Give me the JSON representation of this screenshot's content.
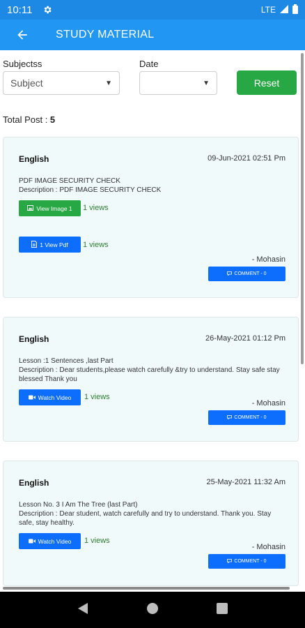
{
  "status_bar": {
    "time": "10:11",
    "network": "LTE"
  },
  "app_bar": {
    "title": "STUDY MATERIAL"
  },
  "filters": {
    "subject_label": "Subjectss",
    "subject_value": "Subject",
    "date_label": "Date",
    "date_value": "",
    "reset_label": "Reset"
  },
  "total_post": {
    "label": "Total Post : ",
    "count": "5"
  },
  "posts": [
    {
      "subject": "English",
      "date": "09-Jun-2021 02:51 Pm",
      "line1": "PDF IMAGE SECURITY CHECK",
      "line2": "Description : PDF IMAGE SECURITY CHECK",
      "image_button": "View Image 1",
      "image_views": "1 views",
      "pdf_button": "1 View Pdf",
      "pdf_views": "1 views",
      "author": "- Mohasin",
      "comment": "COMMENT - 0"
    },
    {
      "subject": "English",
      "date": "26-May-2021 01:12 Pm",
      "line1": "Lesson :1 Sentences ,last Part",
      "line2": "Description : Dear students,please watch carefully &try to understand. Stay safe stay blessed Thank you",
      "video_button": "Watch Video",
      "video_views": "1 views",
      "author": "- Mohasin",
      "comment": "COMMENT - 0"
    },
    {
      "subject": "English",
      "date": "25-May-2021 11:32 Am",
      "line1": "Lesson No. 3 I Am The Tree (last Part)",
      "line2": "Description : Dear student, watch carefully and try to understand. Thank you. Stay safe, stay healthy.",
      "video_button": "Watch Video",
      "video_views": "1 views",
      "author": "- Mohasin",
      "comment": "COMMENT - 0"
    }
  ],
  "colors": {
    "primary": "#2196f3",
    "status_bar": "#1e88e5",
    "green": "#28a745",
    "blue_button": "#0d6efd",
    "card_bg": "#f1fafb"
  },
  "icons": [
    "gear-icon",
    "signal-icon",
    "battery-icon",
    "back-arrow-icon",
    "image-icon",
    "pdf-icon",
    "video-icon",
    "comment-icon",
    "nav-back-icon",
    "nav-home-icon",
    "nav-recents-icon"
  ]
}
